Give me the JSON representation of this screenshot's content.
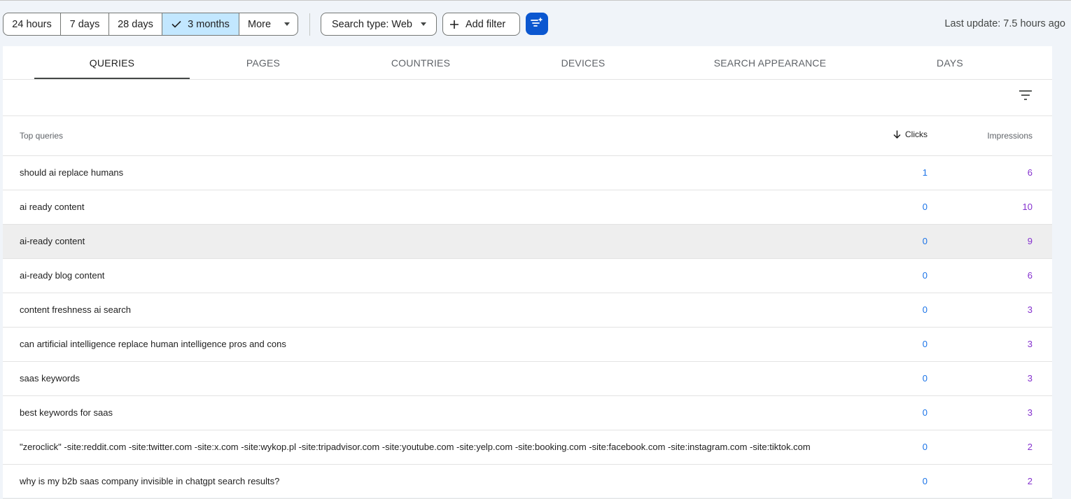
{
  "toolbar": {
    "ranges": [
      "24 hours",
      "7 days",
      "28 days",
      "3 months",
      "More"
    ],
    "selected_range": "3 months",
    "search_type": "Search type: Web",
    "add_filter": "Add filter",
    "last_update": "Last update: 7.5 hours ago"
  },
  "tabs": [
    "QUERIES",
    "PAGES",
    "COUNTRIES",
    "DEVICES",
    "SEARCH APPEARANCE",
    "DAYS"
  ],
  "active_tab": "QUERIES",
  "table": {
    "header": {
      "label": "Top queries",
      "clicks": "Clicks",
      "impressions": "Impressions"
    },
    "sort": "Clicks",
    "rows": [
      {
        "query": "should ai replace humans",
        "clicks": "1",
        "impressions": "6"
      },
      {
        "query": "ai ready content",
        "clicks": "0",
        "impressions": "10"
      },
      {
        "query": "ai-ready content",
        "clicks": "0",
        "impressions": "9"
      },
      {
        "query": "ai-ready blog content",
        "clicks": "0",
        "impressions": "6"
      },
      {
        "query": "content freshness ai search",
        "clicks": "0",
        "impressions": "3"
      },
      {
        "query": "can artificial intelligence replace human intelligence pros and cons",
        "clicks": "0",
        "impressions": "3"
      },
      {
        "query": "saas keywords",
        "clicks": "0",
        "impressions": "3"
      },
      {
        "query": "best keywords for saas",
        "clicks": "0",
        "impressions": "3"
      },
      {
        "query": "\"zeroclick\" -site:reddit.com -site:twitter.com -site:x.com -site:wykop.pl -site:tripadvisor.com -site:youtube.com -site:yelp.com -site:booking.com -site:facebook.com -site:instagram.com -site:tiktok.com",
        "clicks": "0",
        "impressions": "2"
      },
      {
        "query": "why is my b2b saas company invisible in chatgpt search results?",
        "clicks": "0",
        "impressions": "2"
      }
    ]
  },
  "colors": {
    "accent": "#0b57d0",
    "selected_chip": "#c2e7ff",
    "clicks": "#1a73e8",
    "impressions": "#8430ce",
    "row_highlight": "#eeeeee"
  }
}
